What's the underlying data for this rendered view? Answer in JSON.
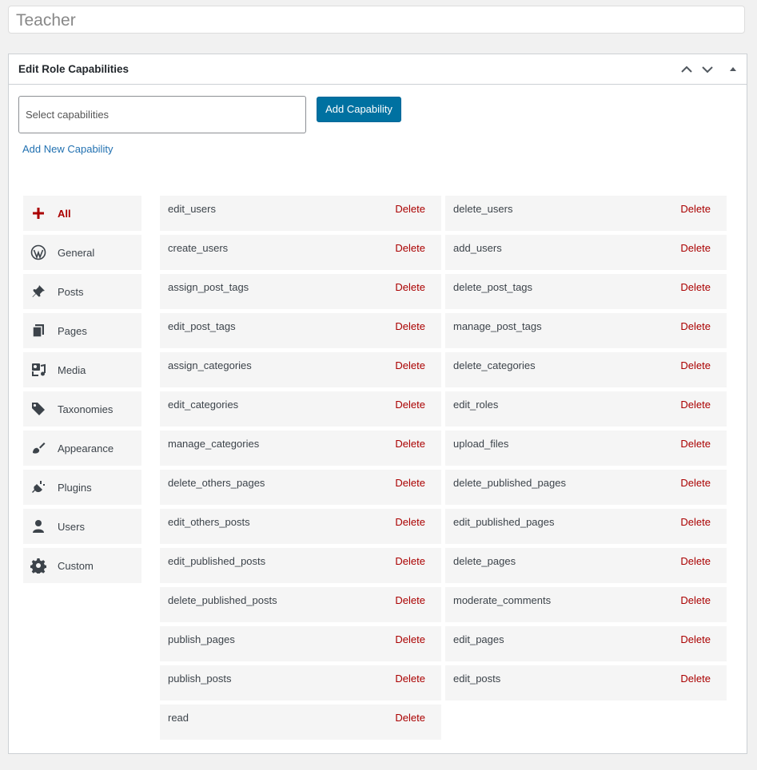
{
  "role_title": "Teacher",
  "box": {
    "title": "Edit Role Capabilities",
    "select_placeholder": "Select capabilities",
    "add_button": "Add Capability",
    "add_new_link": "Add New Capability"
  },
  "categories": [
    {
      "label": "All",
      "icon": "plus-icon",
      "active": true
    },
    {
      "label": "General",
      "icon": "wordpress-icon"
    },
    {
      "label": "Posts",
      "icon": "pushpin-icon"
    },
    {
      "label": "Pages",
      "icon": "pages-icon"
    },
    {
      "label": "Media",
      "icon": "media-icon"
    },
    {
      "label": "Taxonomies",
      "icon": "tag-icon"
    },
    {
      "label": "Appearance",
      "icon": "paintbrush-icon"
    },
    {
      "label": "Plugins",
      "icon": "plug-icon"
    },
    {
      "label": "Users",
      "icon": "user-icon"
    },
    {
      "label": "Custom",
      "icon": "gear-icon"
    }
  ],
  "delete_label": "Delete",
  "capabilities": [
    "edit_users",
    "delete_users",
    "create_users",
    "add_users",
    "assign_post_tags",
    "delete_post_tags",
    "edit_post_tags",
    "manage_post_tags",
    "assign_categories",
    "delete_categories",
    "edit_categories",
    "edit_roles",
    "manage_categories",
    "upload_files",
    "delete_others_pages",
    "delete_published_pages",
    "edit_others_posts",
    "edit_published_pages",
    "edit_published_posts",
    "delete_pages",
    "delete_published_posts",
    "moderate_comments",
    "publish_pages",
    "edit_pages",
    "publish_posts",
    "edit_posts",
    "read"
  ],
  "colors": {
    "accent": "#0071a1",
    "delete": "#aa0000",
    "link": "#2271b1"
  }
}
